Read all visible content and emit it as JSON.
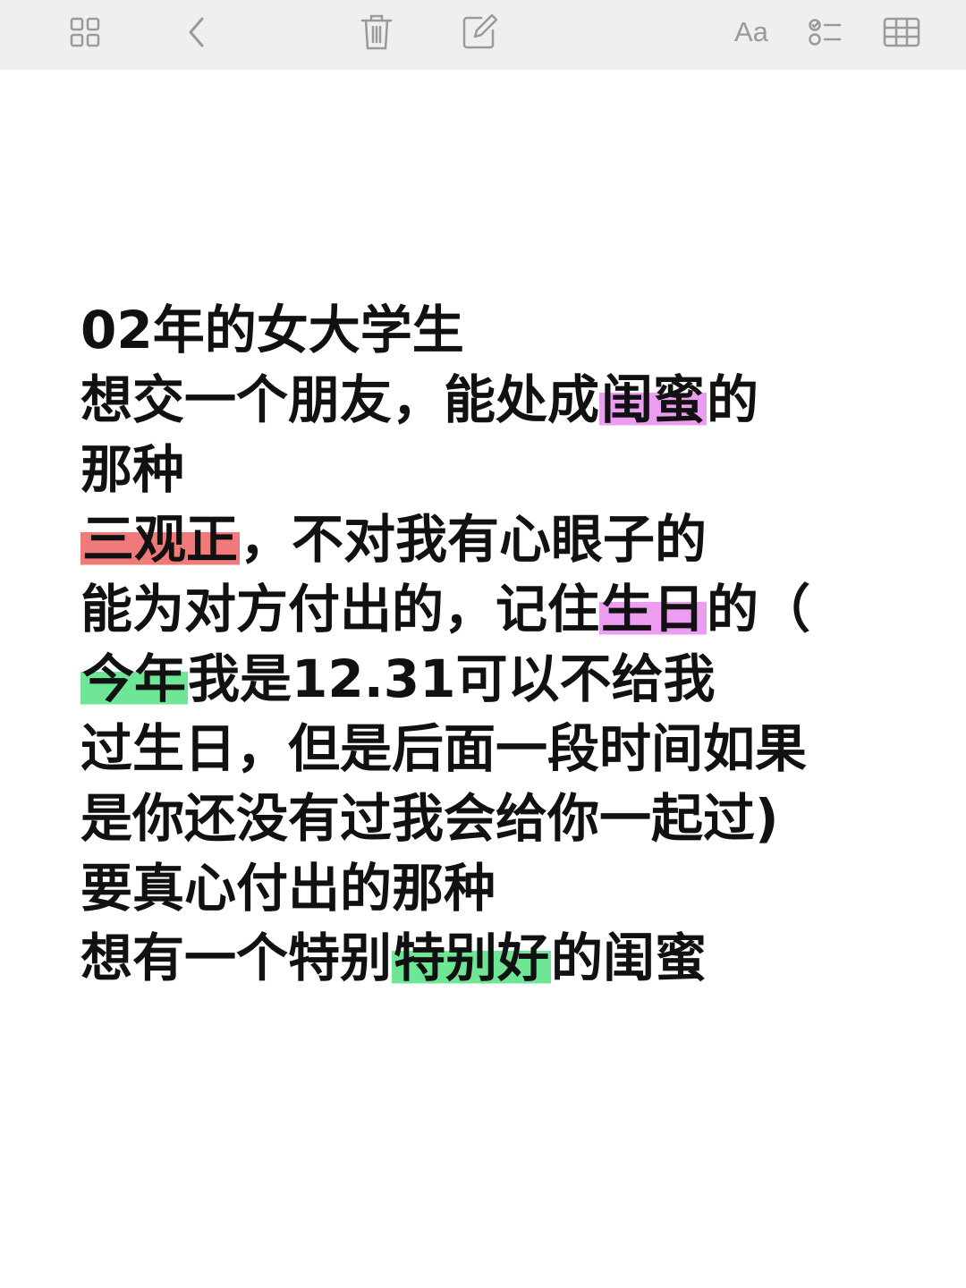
{
  "toolbar": {
    "icons": [
      "grid-icon",
      "back-chevron-icon",
      "trash-icon",
      "compose-icon",
      "format-text-icon",
      "checklist-icon",
      "table-icon"
    ],
    "format_label": "Aa",
    "icon_color": "#9a9a9a",
    "background": "#efefef"
  },
  "note": {
    "lines": [
      [
        {
          "text": "02年的女大学生"
        }
      ],
      [
        {
          "text": "想交一个朋友，能处成"
        },
        {
          "text": "闺蜜",
          "highlight": "#ec9df2"
        },
        {
          "text": "的"
        }
      ],
      [
        {
          "text": "那种"
        }
      ],
      [
        {
          "text": "三观正",
          "highlight": "#f07a7a"
        },
        {
          "text": "，不对我有心眼子的"
        }
      ],
      [
        {
          "text": "能为对方付出的，记住"
        },
        {
          "text": "生日",
          "highlight": "#ec9df2"
        },
        {
          "text": "的（"
        }
      ],
      [
        {
          "text": "今年",
          "highlight": "#6fe696"
        },
        {
          "text": "我是12.31可以不给我"
        }
      ],
      [
        {
          "text": "过生日，但是后面一段时间如果"
        }
      ],
      [
        {
          "text": "是你还没有过我会给你一起过)"
        }
      ],
      [
        {
          "text": "要真心付出的那种"
        }
      ],
      [
        {
          "text": "想有一个特别"
        },
        {
          "text": "特别好",
          "highlight": "#6fe696"
        },
        {
          "text": "的闺蜜"
        }
      ]
    ]
  }
}
